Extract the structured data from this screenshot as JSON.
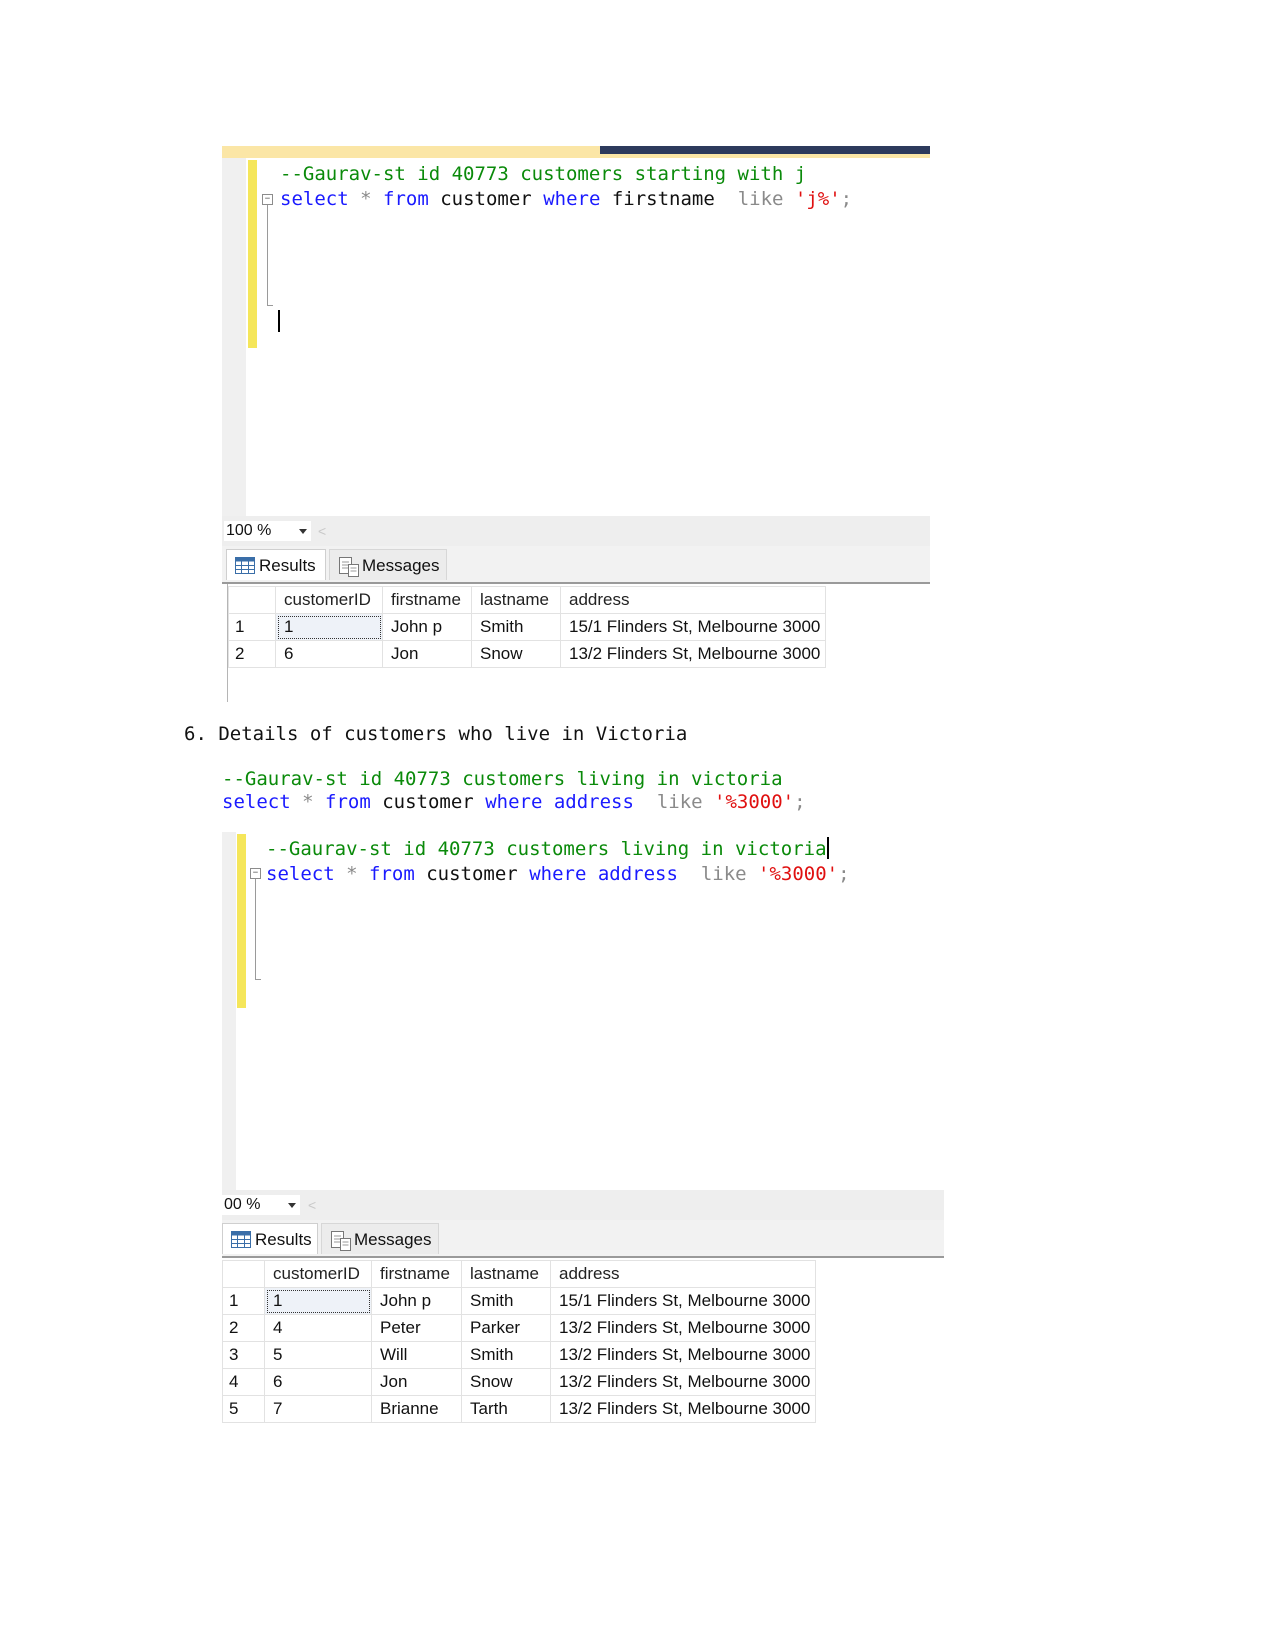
{
  "shot1": {
    "comment": "--Gaurav-st id 40773 customers starting with j",
    "query": {
      "kw_select": "select",
      "star": "*",
      "kw_from": "from",
      "table": "customer",
      "kw_where": "where",
      "column": "firstname",
      "kw_like": "like",
      "pattern": "'j%'",
      "semicolon": ";"
    },
    "zoom": "100 %",
    "tabs": {
      "results": "Results",
      "messages": "Messages"
    },
    "columns": [
      "customerID",
      "firstname",
      "lastname",
      "address"
    ],
    "rows": [
      {
        "n": "1",
        "id": "1",
        "first": "John p",
        "last": "Smith",
        "address": "15/1 Flinders St, Melbourne 3000"
      },
      {
        "n": "2",
        "id": "6",
        "first": "Jon",
        "last": "Snow",
        "address": "13/2 Flinders St, Melbourne 3000"
      }
    ]
  },
  "section6": {
    "heading": "6. Details of customers who live in Victoria",
    "comment": "--Gaurav-st id 40773 customers living in victoria",
    "query": {
      "kw_select": "select",
      "star": "*",
      "kw_from": "from",
      "table": "customer",
      "kw_where": "where",
      "column": "address",
      "kw_like": "like",
      "pattern": "'%3000'",
      "semicolon": ";"
    }
  },
  "shot2": {
    "comment": "--Gaurav-st id 40773 customers living in victoria",
    "query": {
      "kw_select": "select",
      "star": "*",
      "kw_from": "from",
      "table": "customer",
      "kw_where": "where",
      "column": "address",
      "kw_like": "like",
      "pattern": "'%3000'",
      "semicolon": ";"
    },
    "zoom": "00 %",
    "tabs": {
      "results": "Results",
      "messages": "Messages"
    },
    "columns": [
      "customerID",
      "firstname",
      "lastname",
      "address"
    ],
    "rows": [
      {
        "n": "1",
        "id": "1",
        "first": "John p",
        "last": "Smith",
        "address": "15/1 Flinders St, Melbourne 3000"
      },
      {
        "n": "2",
        "id": "4",
        "first": "Peter",
        "last": "Parker",
        "address": "13/2 Flinders St, Melbourne 3000"
      },
      {
        "n": "3",
        "id": "5",
        "first": "Will",
        "last": "Smith",
        "address": "13/2 Flinders St, Melbourne 3000"
      },
      {
        "n": "4",
        "id": "6",
        "first": "Jon",
        "last": "Snow",
        "address": "13/2 Flinders St, Melbourne 3000"
      },
      {
        "n": "5",
        "id": "7",
        "first": "Brianne",
        "last": "Tarth",
        "address": "13/2 Flinders St, Melbourne 3000"
      }
    ]
  }
}
